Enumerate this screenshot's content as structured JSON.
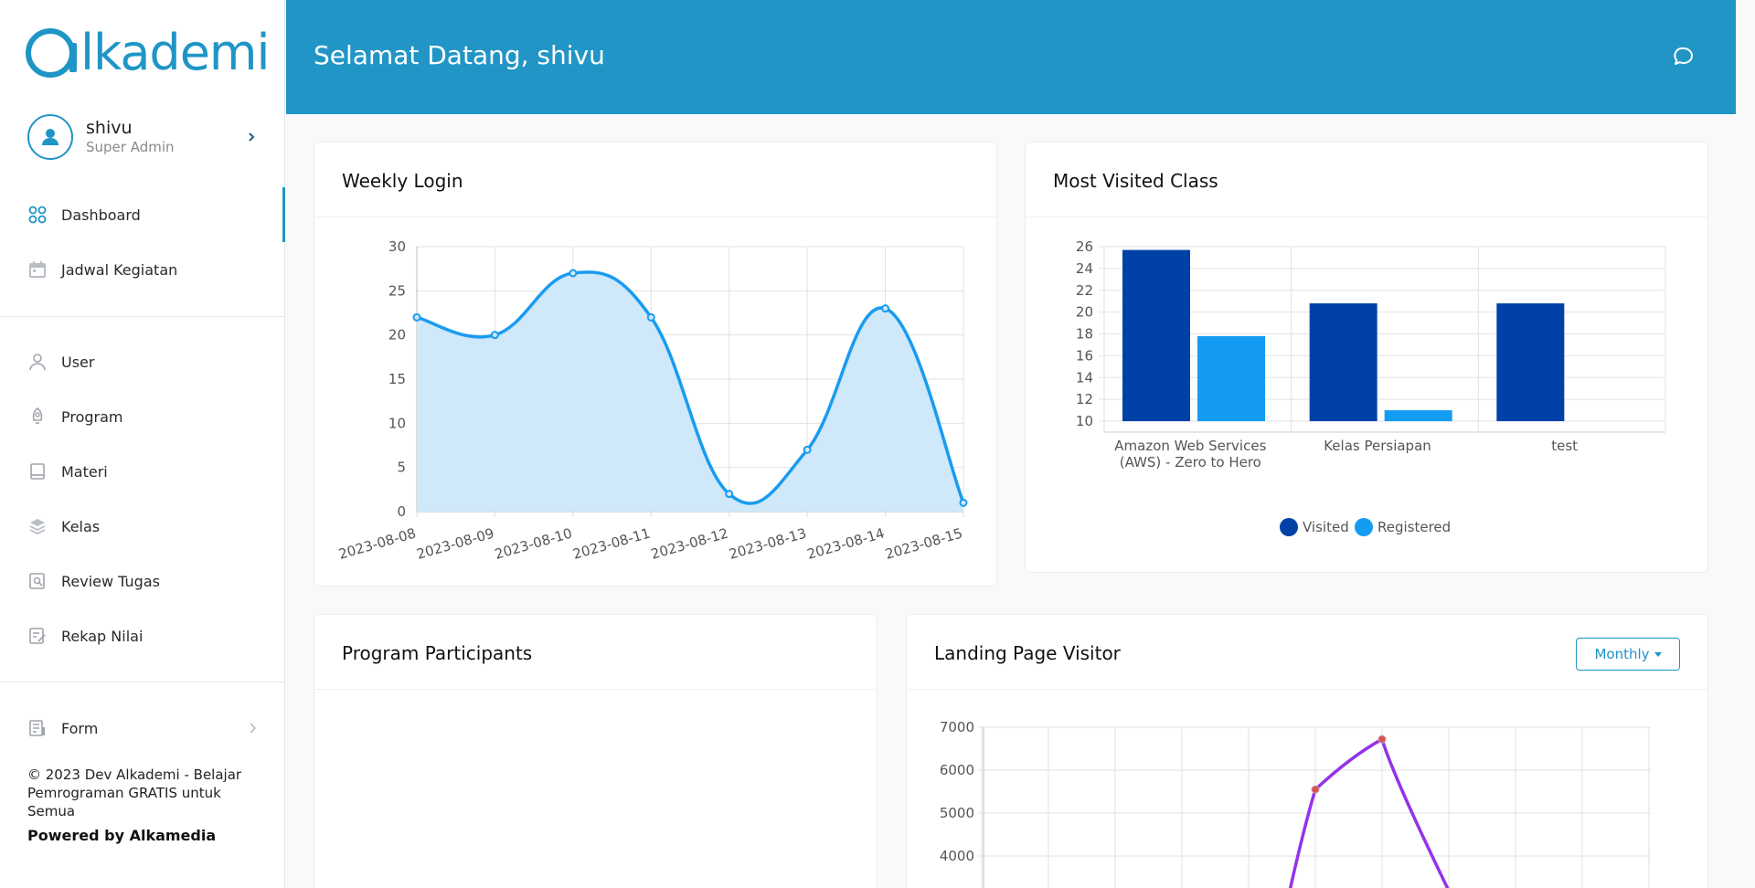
{
  "brand": {
    "name": "lkademi",
    "color": "#1f95c6"
  },
  "user": {
    "name": "shivu",
    "role": "Super Admin"
  },
  "nav_main": [
    {
      "label": "Dashboard",
      "icon": "grid-icon",
      "active": true
    },
    {
      "label": "Jadwal Kegiatan",
      "icon": "calendar-icon"
    }
  ],
  "nav_admin": [
    {
      "label": "User",
      "icon": "user-icon"
    },
    {
      "label": "Program",
      "icon": "rocket-icon"
    },
    {
      "label": "Materi",
      "icon": "book-icon"
    },
    {
      "label": "Kelas",
      "icon": "layers-icon"
    },
    {
      "label": "Review Tugas",
      "icon": "search-doc-icon"
    },
    {
      "label": "Rekap Nilai",
      "icon": "edit-doc-icon"
    }
  ],
  "nav_form": {
    "label": "Form",
    "icon": "form-icon"
  },
  "footer": {
    "copyright": "© 2023 Dev Alkademi - Belajar Pemrograman GRATIS untuk Semua",
    "powered": "Powered by Alkamedia"
  },
  "header": {
    "title": "Selamat Datang, shivu",
    "chat_icon": "chat-icon",
    "bg": "#2196c6"
  },
  "cards": {
    "weekly_login": "Weekly Login",
    "most_visited": "Most Visited Class",
    "program_participants": "Program Participants",
    "landing_visitor": "Landing Page Visitor",
    "monthly_button": "Monthly"
  },
  "chart_data": [
    {
      "type": "area",
      "x": [
        "2023-08-08",
        "2023-08-09",
        "2023-08-10",
        "2023-08-11",
        "2023-08-12",
        "2023-08-13",
        "2023-08-14",
        "2023-08-15"
      ],
      "series": [
        {
          "values": [
            22,
            20,
            27,
            22,
            2,
            7,
            23,
            1
          ],
          "color": "#1a9bf0",
          "fill": "#cfe8fa"
        }
      ],
      "yticks": [
        0,
        5,
        10,
        15,
        20,
        25,
        30
      ],
      "ylim": [
        0,
        30
      ],
      "grid": true
    },
    {
      "type": "bar",
      "categories": [
        [
          "Amazon Web Services",
          "(AWS) - Zero to Hero"
        ],
        [
          "Kelas Persiapan"
        ],
        [
          "test"
        ]
      ],
      "series": [
        {
          "name": "Visited",
          "values": [
            25.7,
            20.8,
            20.8
          ],
          "color": "#0041a8"
        },
        {
          "name": "Registered",
          "values": [
            17.8,
            11,
            10
          ],
          "color": "#149cf2"
        }
      ],
      "yticks": [
        10,
        12,
        14,
        16,
        18,
        20,
        22,
        24,
        26
      ],
      "ylim": [
        10,
        26
      ],
      "legend": "bottom",
      "grid": true
    },
    {
      "type": "line",
      "series": [
        {
          "values": [
            null,
            null,
            null,
            null,
            null,
            5550,
            6720,
            3200,
            null,
            null,
            null
          ],
          "color": "#9333ea",
          "marker": "#d9534f"
        }
      ],
      "yticks": [
        4000,
        5000,
        6000,
        7000
      ],
      "ylim": [
        3000,
        7000
      ],
      "grid": true
    }
  ]
}
